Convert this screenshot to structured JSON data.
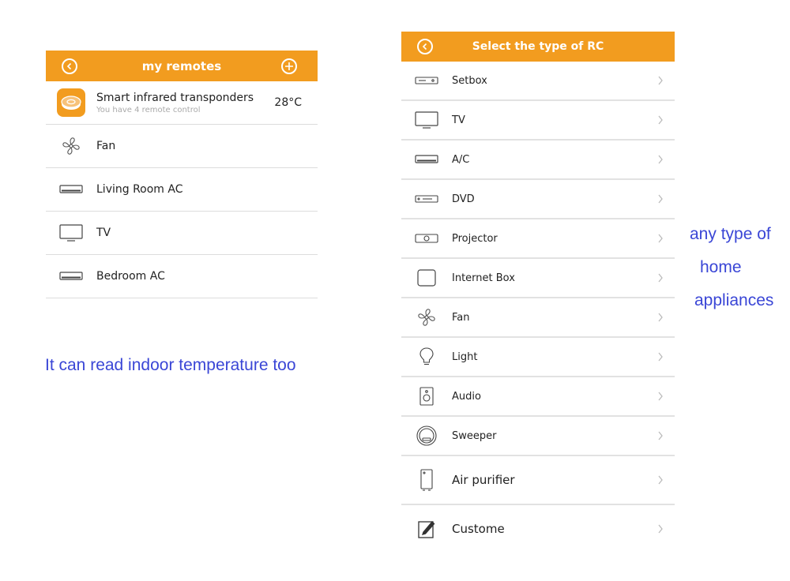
{
  "left": {
    "title": "my remotes",
    "transponder": {
      "name": "Smart infrared transponders",
      "subtitle": "You have 4 remote control",
      "temperature": "28°C"
    },
    "remotes": [
      {
        "label": "Fan",
        "icon": "fan-icon"
      },
      {
        "label": "Living Room AC",
        "icon": "ac-icon"
      },
      {
        "label": "TV",
        "icon": "tv-icon"
      },
      {
        "label": "Bedroom AC",
        "icon": "ac-icon"
      }
    ]
  },
  "right": {
    "title": "Select the type of RC",
    "types": [
      {
        "label": "Setbox",
        "icon": "setbox-icon"
      },
      {
        "label": "TV",
        "icon": "tv-icon"
      },
      {
        "label": "A/C",
        "icon": "ac-icon"
      },
      {
        "label": "DVD",
        "icon": "dvd-icon"
      },
      {
        "label": "Projector",
        "icon": "projector-icon"
      },
      {
        "label": "Internet Box",
        "icon": "internet-box-icon"
      },
      {
        "label": "Fan",
        "icon": "fan-icon"
      },
      {
        "label": "Light",
        "icon": "light-bulb-icon"
      },
      {
        "label": "Audio",
        "icon": "speaker-icon"
      },
      {
        "label": "Sweeper",
        "icon": "robot-vacuum-icon"
      },
      {
        "label": "Air purifier",
        "icon": "air-purifier-icon"
      },
      {
        "label": "Custome",
        "icon": "edit-icon"
      }
    ]
  },
  "captions": {
    "left_note": "It can read indoor temperature too",
    "right_note_lines": [
      "any type of",
      "home",
      "appliances"
    ]
  },
  "colors": {
    "header": "#f29c1f",
    "caption": "#3a46d6"
  }
}
